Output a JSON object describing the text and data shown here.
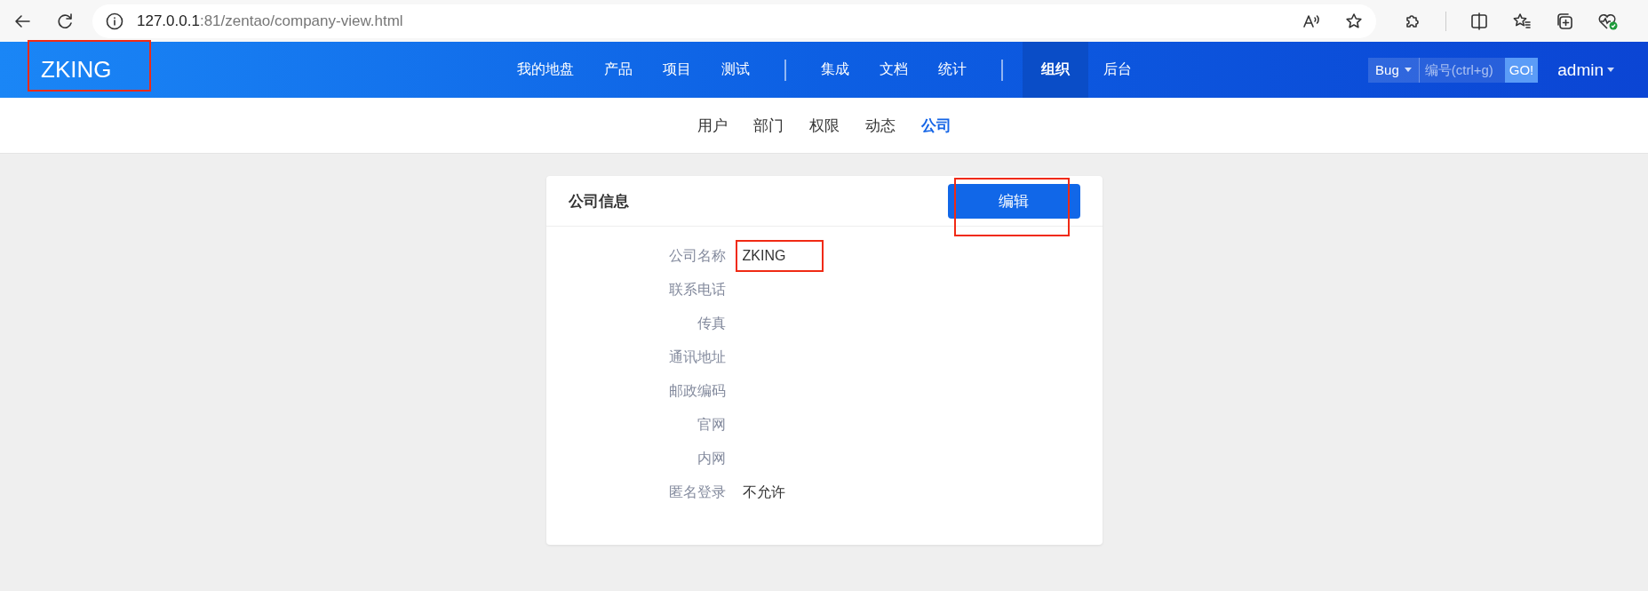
{
  "browser": {
    "url_host": "127.0.0.1",
    "url_path": ":81/zentao/company-view.html"
  },
  "header": {
    "logo": "ZKING",
    "logo_highlighted": true,
    "nav_groups": [
      [
        {
          "label": "我的地盘",
          "selected": false
        },
        {
          "label": "产品",
          "selected": false
        },
        {
          "label": "项目",
          "selected": false
        },
        {
          "label": "测试",
          "selected": false
        }
      ],
      [
        {
          "label": "集成",
          "selected": false
        },
        {
          "label": "文档",
          "selected": false
        },
        {
          "label": "统计",
          "selected": false
        }
      ],
      [
        {
          "label": "组织",
          "selected": true
        },
        {
          "label": "后台",
          "selected": false
        }
      ]
    ],
    "search": {
      "type": "Bug",
      "placeholder": "编号(ctrl+g)",
      "go": "GO!"
    },
    "user": "admin"
  },
  "subnav": [
    {
      "label": "用户",
      "selected": false
    },
    {
      "label": "部门",
      "selected": false
    },
    {
      "label": "权限",
      "selected": false
    },
    {
      "label": "动态",
      "selected": false
    },
    {
      "label": "公司",
      "selected": true
    }
  ],
  "card": {
    "title": "公司信息",
    "edit_button": "编辑",
    "edit_highlighted": true,
    "fields": [
      {
        "label": "公司名称",
        "value": "ZKING",
        "highlighted": true
      },
      {
        "label": "联系电话"
      },
      {
        "label": "传真"
      },
      {
        "label": "通讯地址"
      },
      {
        "label": "邮政编码"
      },
      {
        "label": "官网"
      },
      {
        "label": "内网"
      },
      {
        "label": "匿名登录",
        "value": "不允许"
      }
    ]
  }
}
